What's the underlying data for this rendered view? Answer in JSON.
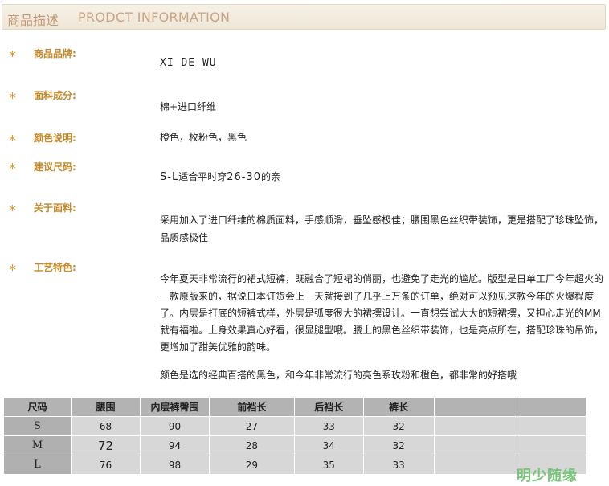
{
  "header": {
    "title_cn": "商品描述",
    "title_en": "PRODCT INFORMATION"
  },
  "star_glyph": "*",
  "fields": {
    "brand": {
      "label": "商品品牌:",
      "value": "XI DE WU"
    },
    "material": {
      "label": "面料成分:",
      "value": "棉+进口纤维"
    },
    "color": {
      "label": "颜色说明:",
      "value": "橙色，枚粉色，黑色"
    },
    "size": {
      "label": "建议尺码:",
      "size_range": "S-L",
      "text1": "适合平时穿",
      "waist_range": "26-30",
      "text2": "的亲"
    },
    "fabric": {
      "label": "关于面料:",
      "line1": "采用加入了进口纤维的棉质面料，手感顺滑，垂坠感极佳；腰围黑色丝织带装饰，更是搭配了珍珠坠饰，",
      "line2": "品质感极佳"
    },
    "craft": {
      "label": "工艺特色:",
      "lines": [
        "今年夏天非常流行的裙式短裤，既融合了短裙的俏丽，也避免了走光的尴尬。版型是日单工厂今年超火的",
        "一款原版来的，据说日本订货会上一天就接到了几乎上万条的订单，绝对可以预见这款今年的火爆程度",
        "了。内层是打底的短裤式样，外层是弧度很大的裙摆设计。一直想尝试大大的短裙摆，又担心走光的MM",
        "就有福啦。上身效果真心好看，很显腿型哦。腰上的黑色丝织带装饰，也是亮点所在，搭配珍珠的吊饰，",
        "更增加了甜美优雅的韵味。"
      ],
      "extra": "颜色是选的经典百搭的黑色，和今年非常流行的亮色系玫粉和橙色，都非常的好搭哦"
    }
  },
  "size_table": {
    "headers": [
      "尺码",
      "腰围",
      "内层裤臀围",
      "前裆长",
      "后裆长",
      "裤长",
      "",
      ""
    ],
    "rows": [
      [
        "S",
        "68",
        "90",
        "27",
        "33",
        "32",
        "",
        ""
      ],
      [
        "M",
        "72",
        "94",
        "28",
        "34",
        "32",
        "",
        ""
      ],
      [
        "L",
        "76",
        "98",
        "29",
        "35",
        "33",
        "",
        ""
      ]
    ]
  },
  "watermark": "明少随缘"
}
